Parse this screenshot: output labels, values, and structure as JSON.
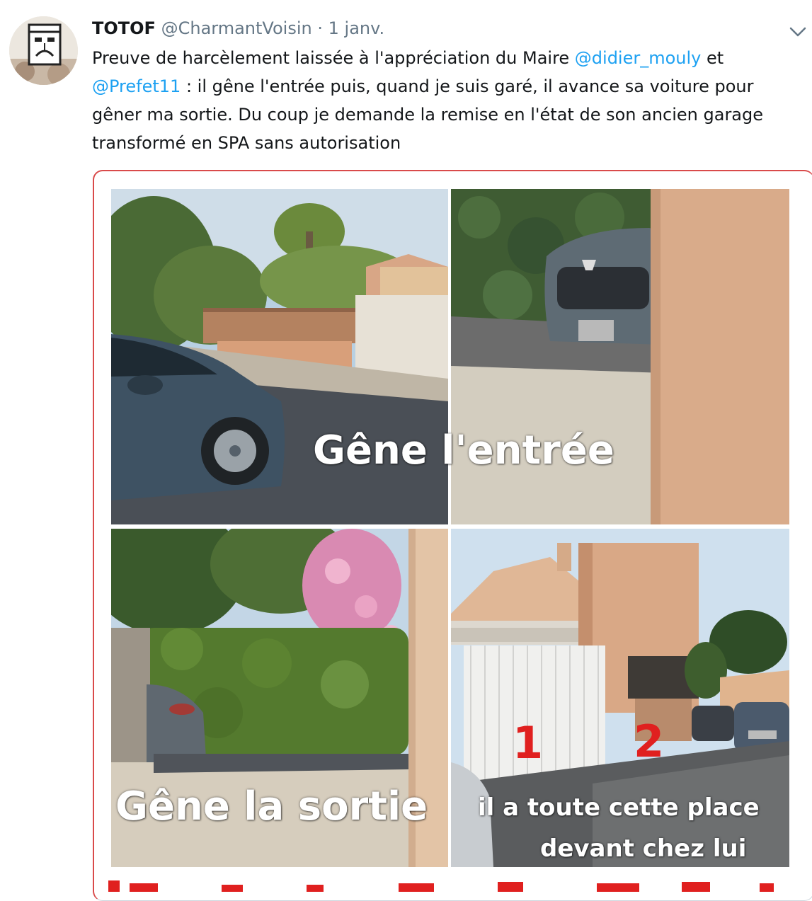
{
  "tweet": {
    "display_name": "TOTOF",
    "handle": "@CharmantVoisin",
    "separator": "·",
    "date": "1 janv.",
    "text_parts": {
      "p1": "Preuve de harcèlement laissée à l'appréciation du Maire ",
      "mention1": "@didier_mouly",
      "p2": " et",
      "mention2": "@Prefet11",
      "p3": " : il gêne l'entrée puis, quand je suis garé, il avance sa voiture pour gêner ma sortie. Du coup je demande la remise en l'état de son ancien garage transformé en SPA sans autorisation"
    }
  },
  "media": {
    "caption_entree": "Gêne l'entrée",
    "caption_sortie": "Gêne la sortie",
    "caption_place_line1": "il a toute cette place",
    "caption_place_line2": "devant chez lui",
    "label_1": "1",
    "label_2": "2"
  },
  "icons": {
    "avatar": "avatar-icon",
    "menu": "chevron-down-icon"
  },
  "colors": {
    "accent": "#1da1f2",
    "secondary_text": "#657786",
    "annotation_red": "#e0201f"
  }
}
